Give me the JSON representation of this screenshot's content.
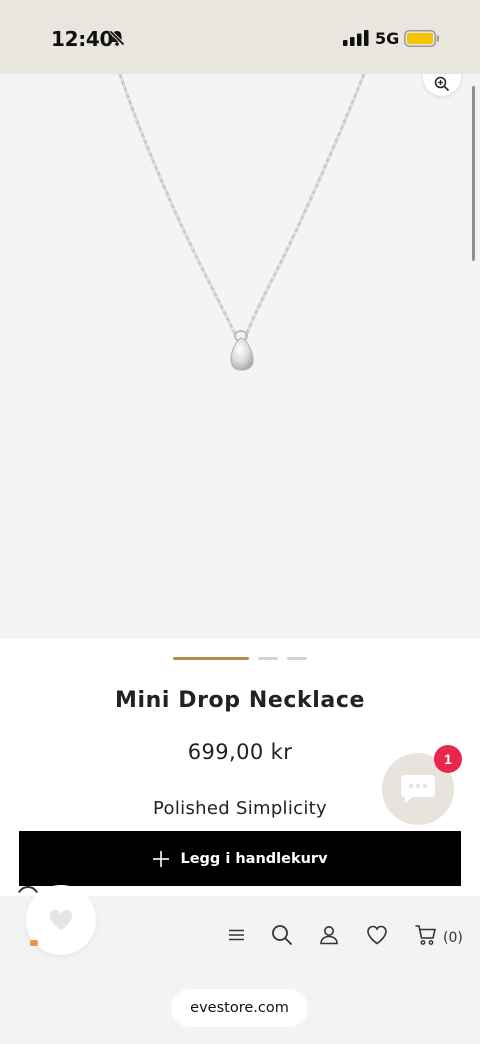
{
  "status_bar": {
    "time": "12:40",
    "network": "5G",
    "silent_icon": "bell-slash-icon",
    "signal_icon": "signal-bars-icon",
    "battery_icon": "battery-icon",
    "battery_color": "#f5c400"
  },
  "product": {
    "image_icon": "silver-drop-necklace",
    "zoom_icon": "zoom-in-icon",
    "slides_total": 3,
    "active_slide": 1,
    "title": "Mini Drop Necklace",
    "price": "699,00 kr",
    "tagline": "Polished Simplicity"
  },
  "cart_button": {
    "label": "Legg i handlekurv",
    "icon": "plus-icon"
  },
  "chat": {
    "icon": "chat-bubble-icon",
    "badge": "1",
    "badge_color": "#e8264e"
  },
  "bottom_nav": {
    "wishlist_fab_icon": "heart-icon",
    "items": [
      {
        "icon": "menu-icon"
      },
      {
        "icon": "search-icon"
      },
      {
        "icon": "account-icon"
      },
      {
        "icon": "heart-icon"
      },
      {
        "icon": "cart-icon"
      }
    ],
    "cart_count": "(0)"
  },
  "browser": {
    "url": "evestore.com"
  },
  "colors": {
    "accent": "#b68c4e",
    "button_bg": "#000000",
    "status_bar_bg": "#e9e5df"
  }
}
